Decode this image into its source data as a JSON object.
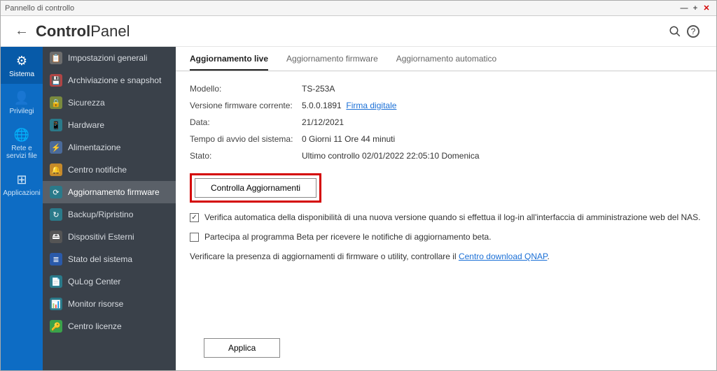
{
  "window": {
    "title": "Pannello di controllo"
  },
  "app": {
    "title_bold": "Control",
    "title_light": "Panel"
  },
  "rail": {
    "items": [
      {
        "icon": "⚙",
        "label": "Sistema"
      },
      {
        "icon": "👤",
        "label": "Privilegi"
      },
      {
        "icon": "🌐",
        "label": "Rete e servizi file"
      },
      {
        "icon": "⊞",
        "label": "Applicazioni"
      }
    ]
  },
  "sidebar": {
    "items": [
      {
        "label": "Impostazioni generali",
        "icon": "📋",
        "bg": "#6d6d6d"
      },
      {
        "label": "Archiviazione e snapshot",
        "icon": "💾",
        "bg": "#b04545"
      },
      {
        "label": "Sicurezza",
        "icon": "🔒",
        "bg": "#7a8a3e"
      },
      {
        "label": "Hardware",
        "icon": "📱",
        "bg": "#2a7a8a"
      },
      {
        "label": "Alimentazione",
        "icon": "⚡",
        "bg": "#4a6a9a"
      },
      {
        "label": "Centro notifiche",
        "icon": "🔔",
        "bg": "#c68a2a"
      },
      {
        "label": "Aggiornamento firmware",
        "icon": "⟳",
        "bg": "#2a7a8a"
      },
      {
        "label": "Backup/Ripristino",
        "icon": "↻",
        "bg": "#2a7a8a"
      },
      {
        "label": "Dispositivi Esterni",
        "icon": "🖴",
        "bg": "#555555"
      },
      {
        "label": "Stato del sistema",
        "icon": "≣",
        "bg": "#2a5aaa"
      },
      {
        "label": "QuLog Center",
        "icon": "📄",
        "bg": "#2a7a8a"
      },
      {
        "label": "Monitor risorse",
        "icon": "📊",
        "bg": "#2a7a8a"
      },
      {
        "label": "Centro licenze",
        "icon": "🔑",
        "bg": "#3aa24a"
      }
    ],
    "selected_index": 6
  },
  "tabs": {
    "items": [
      {
        "label": "Aggiornamento live"
      },
      {
        "label": "Aggiornamento firmware"
      },
      {
        "label": "Aggiornamento automatico"
      }
    ],
    "active_index": 0
  },
  "info": {
    "model_label": "Modello:",
    "model_value": "TS-253A",
    "fw_label": "Versione firmware corrente:",
    "fw_value": "5.0.0.1891",
    "fw_link": "Firma digitale",
    "date_label": "Data:",
    "date_value": "21/12/2021",
    "uptime_label": "Tempo di avvio del sistema:",
    "uptime_value": "0 Giorni 11 Ore 44 minuti",
    "status_label": "Stato:",
    "status_value": "Ultimo controllo 02/01/2022 22:05:10 Domenica"
  },
  "buttons": {
    "check_updates": "Controlla Aggiornamenti",
    "apply": "Applica"
  },
  "checks": {
    "auto_check": {
      "checked": true,
      "label": "Verifica automatica della disponibilità di una nuova versione quando si effettua il log-in all'interfaccia di amministrazione web del NAS."
    },
    "beta": {
      "checked": false,
      "label": "Partecipa al programma Beta per ricevere le notifiche di aggiornamento beta."
    }
  },
  "note": {
    "prefix": "Verificare la presenza di aggiornamenti di firmware o utility, controllare il ",
    "link": "Centro download QNAP",
    "suffix": "."
  }
}
